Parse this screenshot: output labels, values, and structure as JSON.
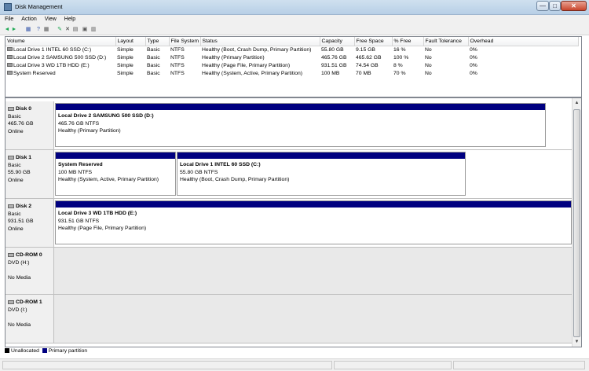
{
  "window": {
    "title": "Disk Management",
    "min": "—",
    "max": "□",
    "close": "✕"
  },
  "menu": [
    "File",
    "Action",
    "View",
    "Help"
  ],
  "toolbar": [
    "◄",
    "►",
    "▦",
    "?",
    "▦",
    "✎",
    "✕",
    "▤",
    "▣",
    "▥"
  ],
  "volumes": {
    "columns": [
      "Volume",
      "Layout",
      "Type",
      "File System",
      "Status",
      "Capacity",
      "Free Space",
      "% Free",
      "Fault Tolerance",
      "Overhead"
    ],
    "rows": [
      [
        "Local Drive 1 INTEL 60 SSD (C:)",
        "Simple",
        "Basic",
        "NTFS",
        "Healthy (Boot, Crash Dump, Primary Partition)",
        "55.80 GB",
        "9.15 GB",
        "16 %",
        "No",
        "0%"
      ],
      [
        "Local Drive 2 SAMSUNG 500 SSD (D:)",
        "Simple",
        "Basic",
        "NTFS",
        "Healthy (Primary Partition)",
        "465.76 GB",
        "465.62 GB",
        "100 %",
        "No",
        "0%"
      ],
      [
        "Local Drive 3 WD 1TB HDD (E:)",
        "Simple",
        "Basic",
        "NTFS",
        "Healthy (Page File, Primary Partition)",
        "931.51 GB",
        "74.54 GB",
        "8 %",
        "No",
        "0%"
      ],
      [
        "System Reserved",
        "Simple",
        "Basic",
        "NTFS",
        "Healthy (System, Active, Primary Partition)",
        "100 MB",
        "70 MB",
        "70 %",
        "No",
        "0%"
      ]
    ]
  },
  "disks": [
    {
      "name": "Disk 0",
      "type": "Basic",
      "size": "465.76 GB",
      "status": "Online",
      "partitions": [
        {
          "name": "Local Drive 2 SAMSUNG 500 SSD  (D:)",
          "fs": "465.76 GB NTFS",
          "status": "Healthy (Primary Partition)"
        }
      ]
    },
    {
      "name": "Disk 1",
      "type": "Basic",
      "size": "55.90 GB",
      "status": "Online",
      "partitions": [
        {
          "name": "System Reserved",
          "fs": "100 MB NTFS",
          "status": "Healthy (System, Active, Primary Partition)"
        },
        {
          "name": "Local Drive 1 INTEL 60 SSD  (C:)",
          "fs": "55.80 GB NTFS",
          "status": "Healthy (Boot, Crash Dump, Primary Partition)"
        }
      ]
    },
    {
      "name": "Disk 2",
      "type": "Basic",
      "size": "931.51 GB",
      "status": "Online",
      "partitions": [
        {
          "name": "Local Drive 3 WD 1TB HDD  (E:)",
          "fs": "931.51 GB NTFS",
          "status": "Healthy (Page File, Primary Partition)"
        }
      ]
    },
    {
      "name": "CD-ROM 0",
      "type": "DVD (H:)",
      "media": "No Media"
    },
    {
      "name": "CD-ROM 1",
      "type": "DVD (I:)",
      "media": "No Media"
    }
  ],
  "legend": {
    "unallocated": "Unallocated",
    "primary": "Primary partition",
    "unallocated_color": "#000000",
    "primary_color": "#000080"
  }
}
